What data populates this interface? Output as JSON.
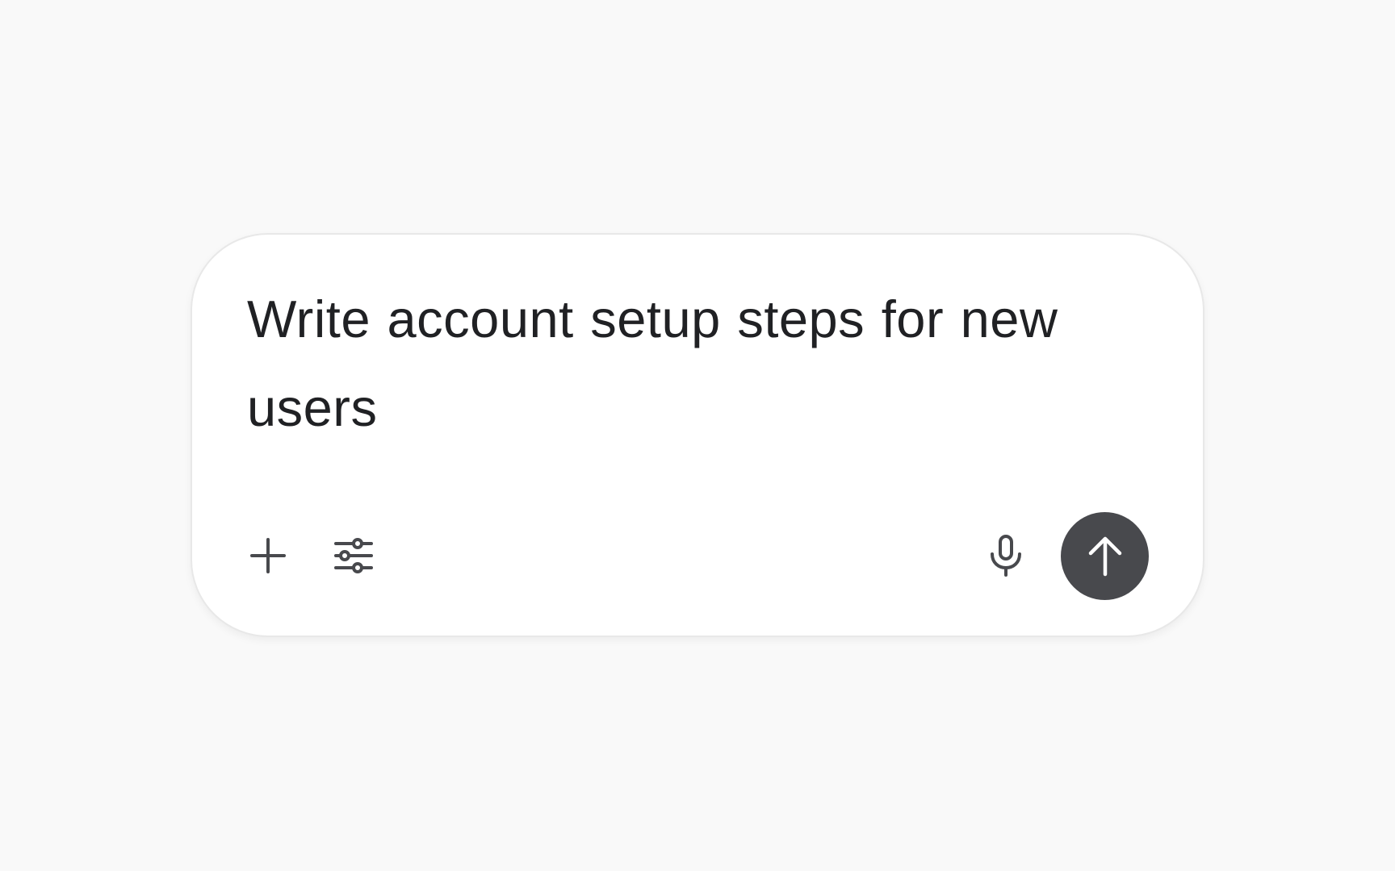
{
  "composer": {
    "prompt_text": "Write account setup steps for new users",
    "toolbar": {
      "left_icons": [
        "plus-icon",
        "sliders-icon"
      ],
      "right_icons": [
        "microphone-icon",
        "arrow-up-icon"
      ]
    },
    "colors": {
      "page_background": "#f9f9f9",
      "card_background": "#ffffff",
      "text": "#202124",
      "icon": "#48494d",
      "send_button": "#48494d",
      "send_icon": "#ffffff"
    }
  }
}
